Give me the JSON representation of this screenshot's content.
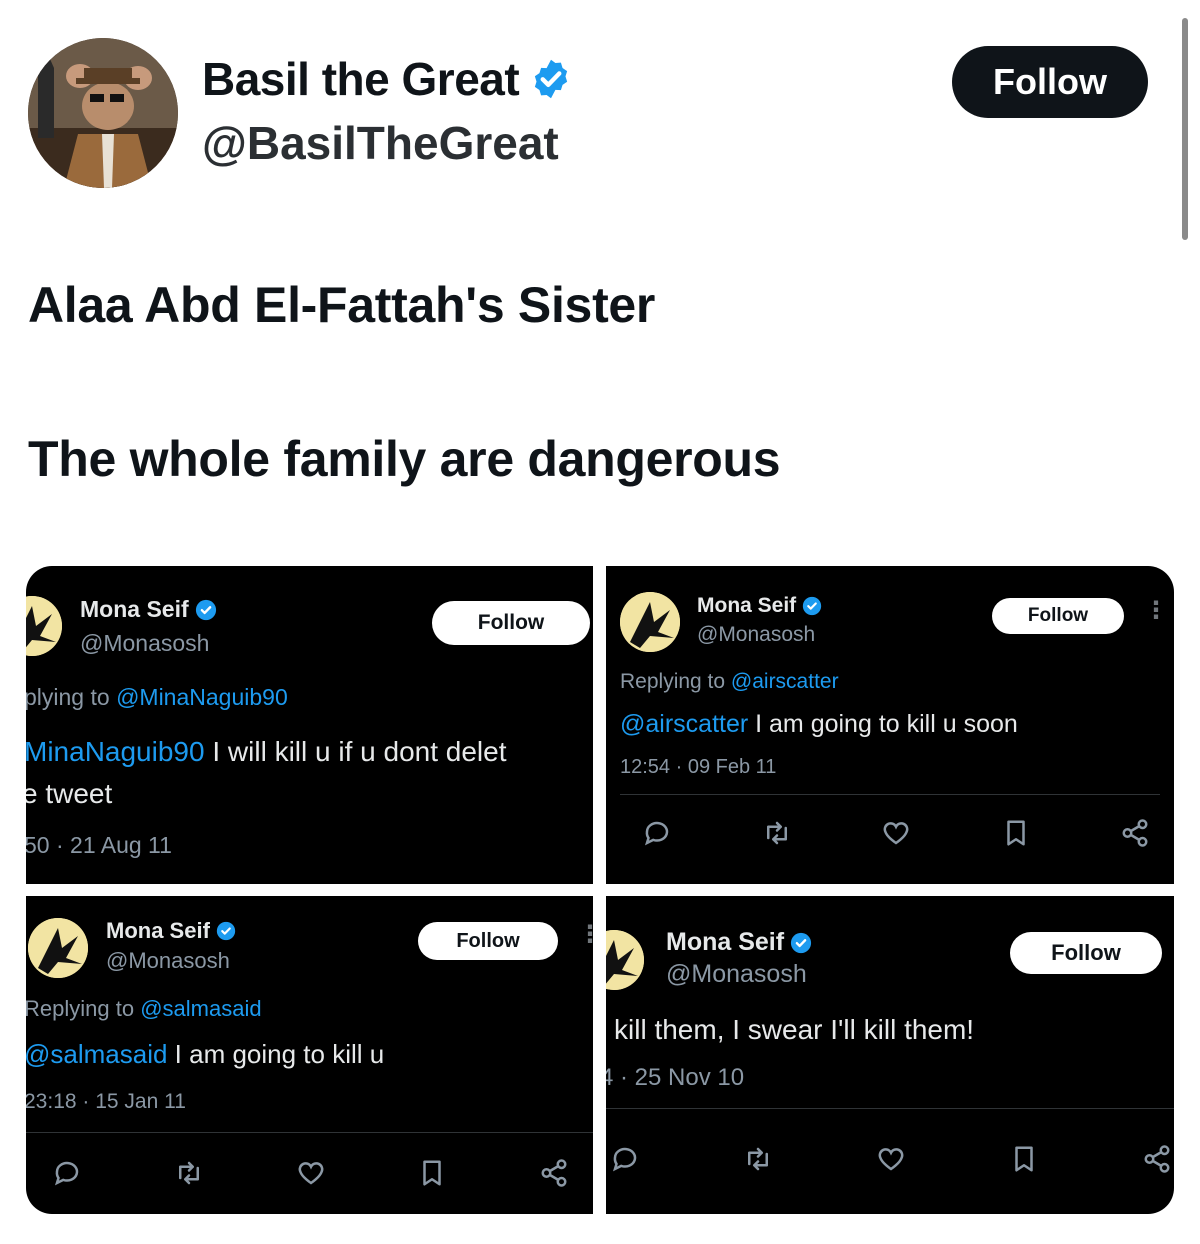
{
  "profile": {
    "display_name": "Basil the Great",
    "handle": "@BasilTheGreat",
    "follow_label": "Follow",
    "verified_color": "#1d9bf0"
  },
  "post": {
    "line1": "Alaa Abd El-Fattah's Sister",
    "line2": "The whole family are dangerous"
  },
  "embedded_tweets": [
    {
      "name": "Mona Seif",
      "handle": "@Monasosh",
      "follow_label": "Follow",
      "reply_prefix": "plying to ",
      "reply_mention": "@MinaNaguib90",
      "text_mention": "MinaNaguib90",
      "text_line1": " I will kill u if u dont delet",
      "text_line2": "e tweet",
      "timestamp": "50 · 21 Aug 11"
    },
    {
      "name": "Mona Seif",
      "handle": "@Monasosh",
      "follow_label": "Follow",
      "reply_prefix": "Replying to ",
      "reply_mention": "@airscatter",
      "text_mention": "@airscatter",
      "text_line1": " I am going to kill u soon",
      "timestamp": "12:54 · 09 Feb 11"
    },
    {
      "name": "Mona Seif",
      "handle": "@Monasosh",
      "follow_label": "Follow",
      "reply_prefix": "Replying to ",
      "reply_mention": "@salmasaid",
      "text_mention": "@salmasaid",
      "text_line1": " I am going to kill u",
      "timestamp": "23:18 · 15 Jan 11"
    },
    {
      "name": "Mona Seif",
      "handle": "@Monasosh",
      "follow_label": "Follow",
      "text_line1": "kill them, I swear I'll kill them!",
      "timestamp": "4 · 25 Nov 10"
    }
  ],
  "icons": {
    "verified": "verified-badge-icon",
    "reply": "reply-icon",
    "retweet": "retweet-icon",
    "like": "like-icon",
    "bookmark": "bookmark-icon",
    "share": "share-icon",
    "more": "more-icon"
  }
}
